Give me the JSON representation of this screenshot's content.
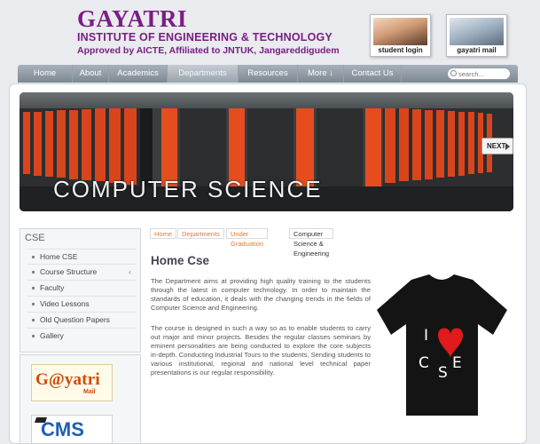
{
  "header": {
    "title": "GAYATRI",
    "subtitle": "INSTITUTE OF ENGINEERING & TECHNOLOGY",
    "approval": "Approved by AICTE, Affiliated to JNTUK, Jangareddigudem"
  },
  "quick_links": [
    {
      "label": "student login",
      "icon": "student-photo"
    },
    {
      "label": "gayatri mail",
      "icon": "students-photo"
    }
  ],
  "nav": {
    "items": [
      {
        "label": "Home"
      },
      {
        "label": "About"
      },
      {
        "label": "Academics"
      },
      {
        "label": "Departments",
        "active": true
      },
      {
        "label": "Resources"
      },
      {
        "label": "More ↓"
      },
      {
        "label": "Contact Us"
      }
    ],
    "search_placeholder": "search..."
  },
  "banner": {
    "caption": "COMPUTER SCIENCE",
    "next_label": "NEXT",
    "accent_color": "#e0461f"
  },
  "sidebar": {
    "title": "CSE",
    "items": [
      {
        "label": "Home CSE"
      },
      {
        "label": "Course Structure",
        "has_submenu": true,
        "chevron": "‹"
      },
      {
        "label": "Faculty"
      },
      {
        "label": "Video Lessons"
      },
      {
        "label": "Old Question Papers"
      },
      {
        "label": "Gallery"
      }
    ]
  },
  "promos": {
    "mail_text": "G@yatri",
    "mail_small": "Mail",
    "cms_text": "CMS"
  },
  "breadcrumb": [
    "Home",
    "Departments",
    "Under Graduation",
    "Computer Science & Engineering"
  ],
  "main": {
    "title": "Home Cse",
    "paragraphs": [
      "The Department aims at providing high quality training to the students through the latest in computer technology. In order to maintain the standards of education, it deals with the changing trends in the fields of Computer Science and Engineering.",
      "The course is designed in such a way so as to enable students to carry out major and minor projects. Besides the regular classes seminars by eminent personalities are being conducted to explore the core subjects in-depth. Conducting Industrial Tours to the students, Sending students to various institutional, regional and national level technical paper presentations is our regular responsibility."
    ],
    "tshirt_letters": [
      "I",
      "C",
      "S",
      "E"
    ]
  },
  "colors": {
    "brand": "#7b1c87",
    "nav": "#8a949e",
    "breadcrumb_link": "#e4793a"
  }
}
